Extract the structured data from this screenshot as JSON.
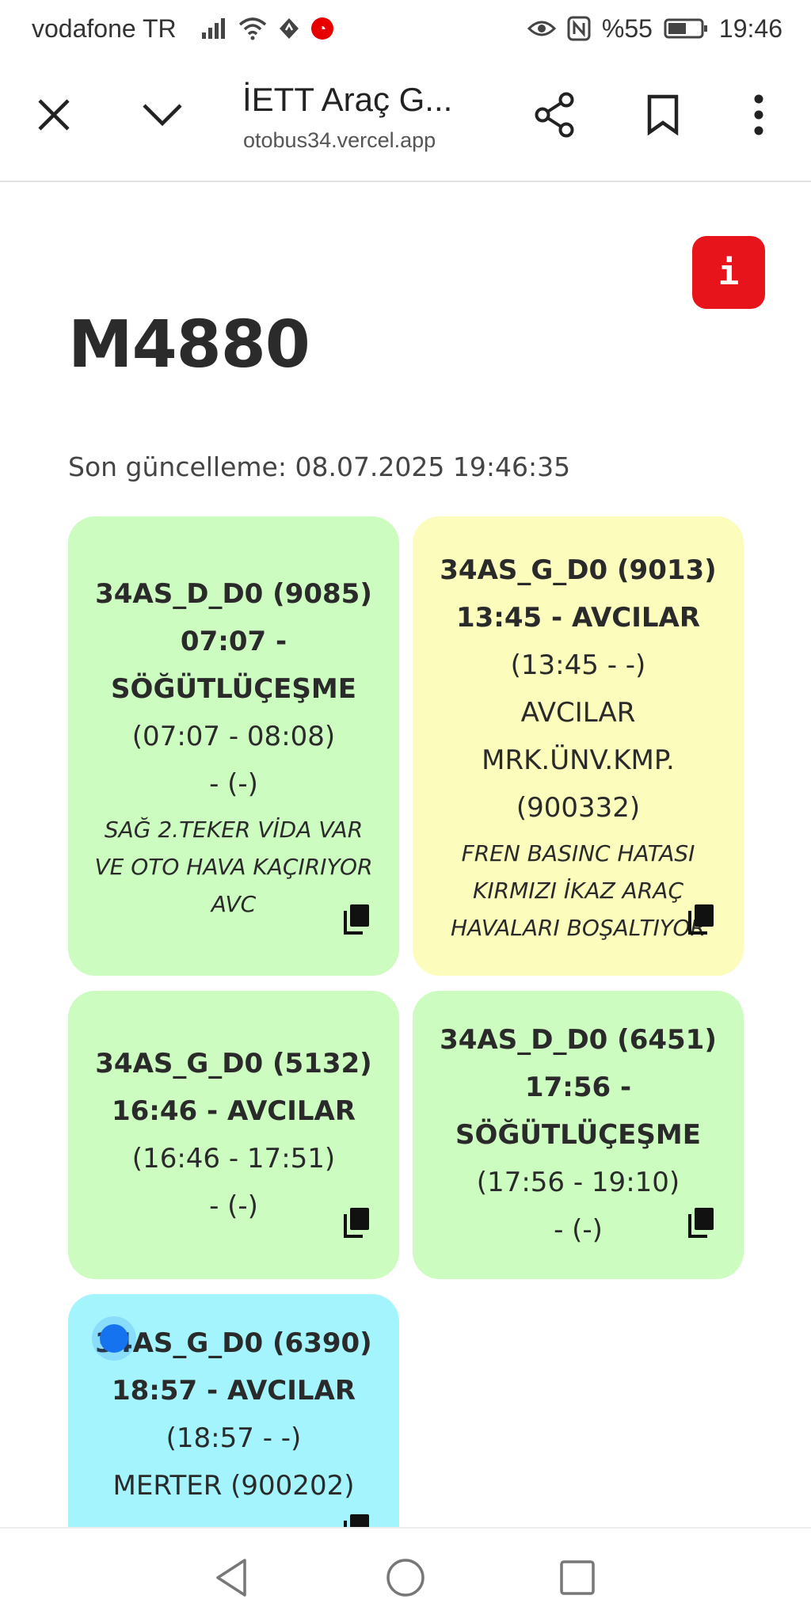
{
  "status_bar": {
    "carrier": "vodafone TR",
    "battery": "%55",
    "time": "19:46",
    "icons": [
      "signal-icon",
      "wifi-icon",
      "navigation-icon",
      "vodafone-icon",
      "eye-icon",
      "nfc-icon",
      "battery-icon"
    ]
  },
  "toolbar": {
    "title": "İETT Araç G...",
    "url": "otobus34.vercel.app"
  },
  "page": {
    "info_label": "i",
    "title": "M4880",
    "last_update": "Son güncelleme: 08.07.2025 19:46:35"
  },
  "cards": [
    {
      "color": "#ccfcc0",
      "line1": "34AS_D_D0 (9085)",
      "line2": "07:07 -",
      "line3": "SÖĞÜTLÜÇEŞME",
      "line4": "(07:07 - 08:08)",
      "line5": "- (-)",
      "note": "SAĞ 2.TEKER VİDA VAR VE OTO HAVA KAÇIRIYOR AVC"
    },
    {
      "color": "#fcfcbc",
      "line1": "34AS_G_D0 (9013)",
      "line2": "13:45 - AVCILAR",
      "line3": "(13:45 - -)",
      "line4": "AVCILAR",
      "line5": "MRK.ÜNV.KMP.",
      "line6": "(900332)",
      "note": "FREN BASINC HATASI KIRMIZI İKAZ ARAÇ HAVALARI BOŞALTIYOR"
    },
    {
      "color": "#ccfcc0",
      "line1": "34AS_G_D0 (5132)",
      "line2": "16:46 - AVCILAR",
      "line3": "(16:46 - 17:51)",
      "line4": "- (-)"
    },
    {
      "color": "#ccfcc0",
      "line1": "34AS_D_D0 (6451)",
      "line2": "17:56 -",
      "line3": "SÖĞÜTLÜÇEŞME",
      "line4": "(17:56 - 19:10)",
      "line5": "- (-)"
    },
    {
      "color": "#a3f4fd",
      "line1": "34AS_G_D0 (6390)",
      "line2": "18:57 - AVCILAR",
      "line3": "(18:57 - -)",
      "line4": "MERTER (900202)"
    }
  ]
}
